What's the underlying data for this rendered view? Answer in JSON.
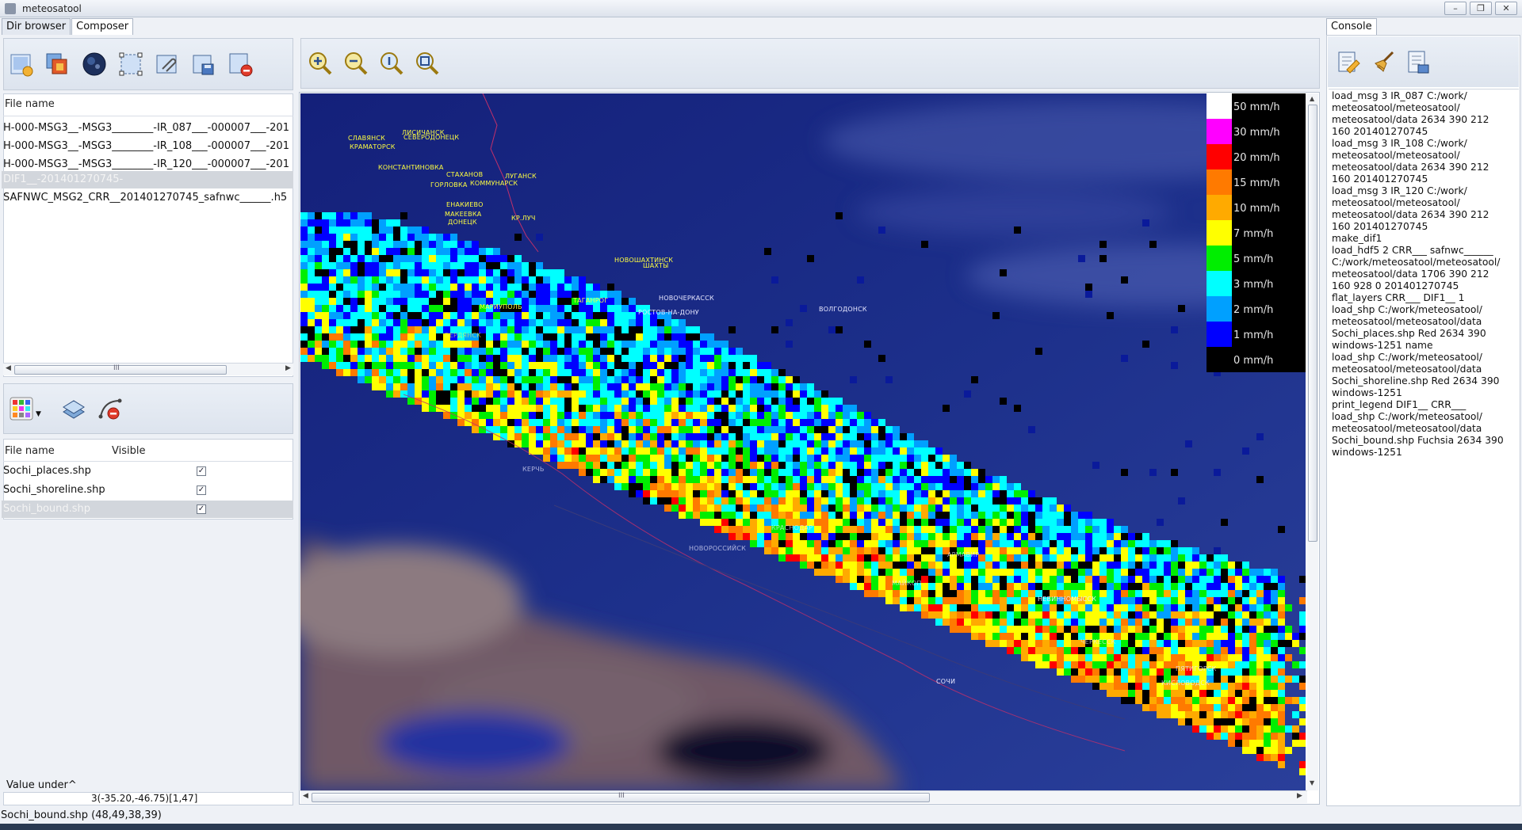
{
  "window": {
    "title": "meteosatool",
    "buttons": [
      "–",
      "❐",
      "✕"
    ]
  },
  "left_tabs": [
    "Dir browser",
    "Composer"
  ],
  "top_toolbar_icons": [
    "new-image-icon",
    "layers-copy-icon",
    "globe-icon",
    "crop-selection-icon",
    "attach-icon",
    "save-image-icon",
    "delete-image-icon"
  ],
  "file_list": {
    "header": "File name",
    "rows": [
      "H-000-MSG3__-MSG3________-IR_087___-000007___-201",
      "H-000-MSG3__-MSG3________-IR_108___-000007___-201",
      "H-000-MSG3__-MSG3________-IR_120___-000007___-201",
      "DIF1__-201401270745-",
      "SAFNWC_MSG2_CRR__201401270745_safnwc______.h5"
    ],
    "selected_index": 3,
    "scroll_grip": "III"
  },
  "layer_toolbar_icons": [
    "palette-icon",
    "dropdown-arrow-icon",
    "layers-stack-icon",
    "remove-curve-icon"
  ],
  "layers": {
    "headers": [
      "File name",
      "Visible"
    ],
    "rows": [
      {
        "name": "Sochi_places.shp",
        "visible": "✓"
      },
      {
        "name": "Sochi_shoreline.shp",
        "visible": "✓"
      },
      {
        "name": "Sochi_bound.shp",
        "visible": "✓"
      }
    ],
    "selected_index": 2
  },
  "value_under": {
    "label": "Value under^",
    "value": "3(-35.20,-46.75)[1,47]"
  },
  "zoom_toolbar_icons": [
    "zoom-in-icon",
    "zoom-out-icon",
    "zoom-reset-icon",
    "zoom-fit-icon"
  ],
  "map_scroll_grip": "III",
  "legend": [
    {
      "label": "50 mm/h",
      "color": "#ffffff"
    },
    {
      "label": "30 mm/h",
      "color": "#ff00ff"
    },
    {
      "label": "20 mm/h",
      "color": "#ff0000"
    },
    {
      "label": "15 mm/h",
      "color": "#ff7a00"
    },
    {
      "label": "10 mm/h",
      "color": "#ffaa00"
    },
    {
      "label": "7 mm/h",
      "color": "#ffff00"
    },
    {
      "label": "5 mm/h",
      "color": "#00ee00"
    },
    {
      "label": "3 mm/h",
      "color": "#00ffff"
    },
    {
      "label": "2 mm/h",
      "color": "#00a0ff"
    },
    {
      "label": "1 mm/h",
      "color": "#0000ff"
    },
    {
      "label": "0 mm/h",
      "color": "#000000"
    }
  ],
  "cities": [
    "СЛАВЯНСК",
    "КРАМАТОРСК",
    "ЛИСИЧАНСК",
    "СЕВЕРОДОНЕЦК",
    "КОНСТАНТИНОВКА",
    "СТАХАНОВ",
    "ЛУГАНСК",
    "ГОРЛОВКА",
    "КОММУНАРСК",
    "ЕНАКИЕВО",
    "МАКЕЕВКА",
    "ДОНЕЦК",
    "КР.ЛУЧ",
    "НОВОШАХТИНСК",
    "ШАХТЫ",
    "ТАГАНРОГ",
    "МАРИУПОЛЬ",
    "НОВОЧЕРКАССК",
    "РОСТОВ-НА-ДОНУ",
    "ВОЛГОДОНСК",
    "БЕРДЯНСК",
    "КЕРЧЬ",
    "НОВОРОССИЙСК",
    "КРАСНОДАР",
    "АРМАВИР",
    "МАЙКОП",
    "НЕВИННОМЫССК",
    "СОЧИ",
    "ЧЕРКЕССК",
    "ПЯТИГОРСК",
    "КИСЛОВОДСК"
  ],
  "console": {
    "tab": "Console",
    "toolbar_icons": [
      "run-script-icon",
      "broom-icon",
      "script-doc-icon"
    ],
    "lines": [
      "load_msg 3 IR_087 C:/work/",
      "meteosatool/meteosatool/",
      "meteosatool/data 2634 390 212",
      "160 201401270745",
      "load_msg 3 IR_108 C:/work/",
      "meteosatool/meteosatool/",
      "meteosatool/data 2634 390 212",
      "160 201401270745",
      "load_msg 3 IR_120 C:/work/",
      "meteosatool/meteosatool/",
      "meteosatool/data 2634 390 212",
      "160 201401270745",
      "make_dif1",
      "load_hdf5 2 CRR___ safnwc______",
      "C:/work/meteosatool/meteosatool/",
      "meteosatool/data 1706 390 212",
      "160 928 0 201401270745",
      "flat_layers CRR___ DIF1__ 1",
      "load_shp C:/work/meteosatool/",
      "meteosatool/meteosatool/data",
      "Sochi_places.shp Red 2634 390",
      "windows-1251 name",
      "load_shp C:/work/meteosatool/",
      "meteosatool/meteosatool/data",
      "Sochi_shoreline.shp Red 2634 390",
      "windows-1251",
      "print_legend DIF1__ CRR___",
      "load_shp C:/work/meteosatool/",
      "meteosatool/meteosatool/data",
      "Sochi_bound.shp Fuchsia 2634 390",
      "windows-1251"
    ]
  },
  "status": "Sochi_bound.shp (48,49,38,39)"
}
